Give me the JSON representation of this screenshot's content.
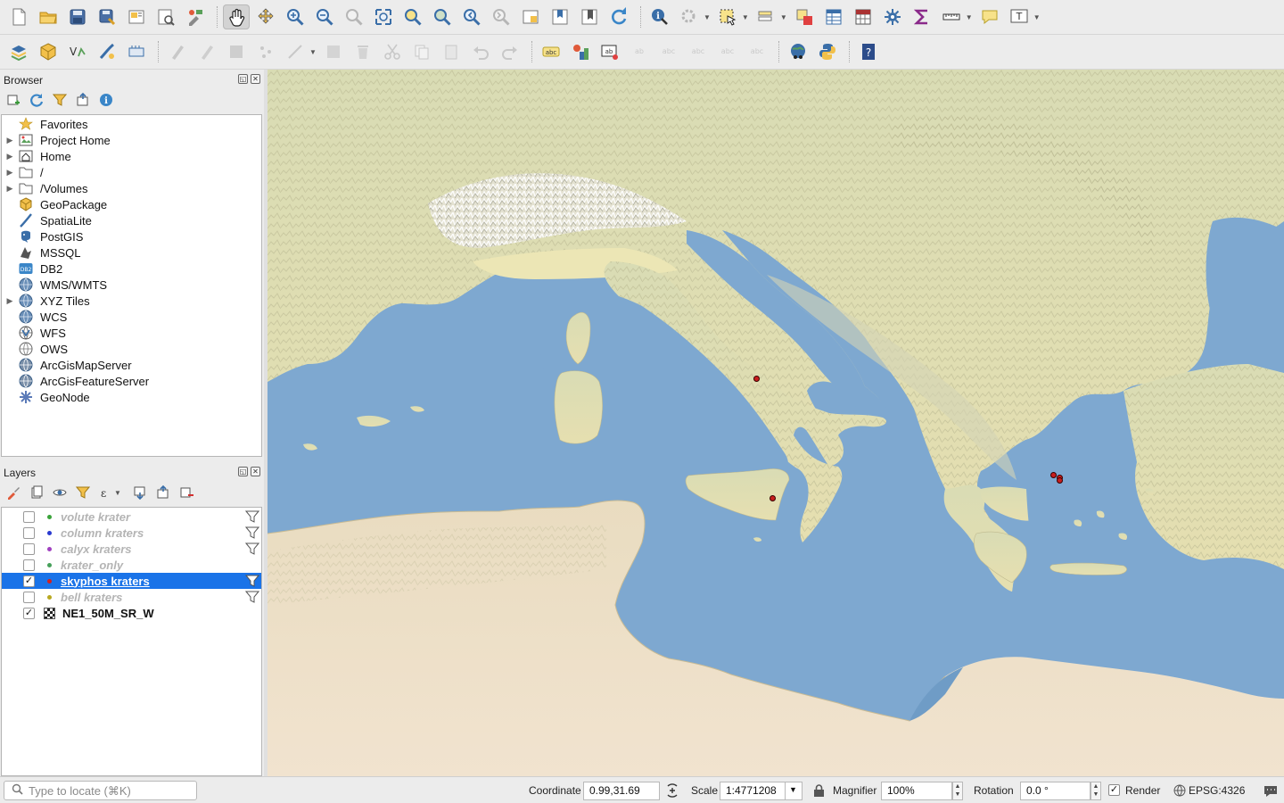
{
  "toolbar_main": {
    "items": [
      "new-project-icon",
      "open-project-icon",
      "save-project-icon",
      "save-as-icon",
      "print-layout-icon",
      "layout-manager-icon",
      "style-manager-icon",
      "pan-icon",
      "pan-to-selection-icon",
      "zoom-in-icon",
      "zoom-out-icon",
      "zoom-native-icon",
      "zoom-full-icon",
      "zoom-to-selection-icon",
      "zoom-to-layer-icon",
      "zoom-last-icon",
      "zoom-next-icon",
      "new-map-view-icon",
      "new-bookmark-icon",
      "show-bookmarks-icon",
      "refresh-icon",
      "identify-icon",
      "run-action-icon",
      "select-features-icon",
      "select-by-value-icon",
      "deselect-icon",
      "attribute-table-icon",
      "field-calculator-icon",
      "toolbox-icon",
      "statistics-icon",
      "measure-icon",
      "map-tips-icon",
      "text-annotation-icon"
    ]
  },
  "browser": {
    "title": "Browser",
    "items": [
      {
        "label": "Favorites",
        "icon": "star-icon",
        "expandable": false
      },
      {
        "label": "Project Home",
        "icon": "project-home-icon",
        "expandable": true
      },
      {
        "label": "Home",
        "icon": "home-icon",
        "expandable": true
      },
      {
        "label": "/",
        "icon": "folder-icon",
        "expandable": true
      },
      {
        "label": "/Volumes",
        "icon": "folder-icon",
        "expandable": true
      },
      {
        "label": "GeoPackage",
        "icon": "geopackage-icon",
        "expandable": false
      },
      {
        "label": "SpatiaLite",
        "icon": "spatialite-icon",
        "expandable": false
      },
      {
        "label": "PostGIS",
        "icon": "postgis-icon",
        "expandable": false
      },
      {
        "label": "MSSQL",
        "icon": "mssql-icon",
        "expandable": false
      },
      {
        "label": "DB2",
        "icon": "db2-icon",
        "expandable": false
      },
      {
        "label": "WMS/WMTS",
        "icon": "globe-icon",
        "expandable": false
      },
      {
        "label": "XYZ Tiles",
        "icon": "globe-icon",
        "expandable": true
      },
      {
        "label": "WCS",
        "icon": "globe-icon",
        "expandable": false
      },
      {
        "label": "WFS",
        "icon": "wfs-icon",
        "expandable": false
      },
      {
        "label": "OWS",
        "icon": "ows-icon",
        "expandable": false
      },
      {
        "label": "ArcGisMapServer",
        "icon": "arcgis-icon",
        "expandable": false
      },
      {
        "label": "ArcGisFeatureServer",
        "icon": "arcgis-icon",
        "expandable": false
      },
      {
        "label": "GeoNode",
        "icon": "geonode-icon",
        "expandable": false
      }
    ]
  },
  "layers": {
    "title": "Layers",
    "items": [
      {
        "name": "volute krater",
        "checked": false,
        "color": "#3aa33a",
        "filtered": true,
        "selected": false
      },
      {
        "name": "column kraters",
        "checked": false,
        "color": "#2a3ad0",
        "filtered": true,
        "selected": false
      },
      {
        "name": "calyx kraters",
        "checked": false,
        "color": "#a040c0",
        "filtered": true,
        "selected": false
      },
      {
        "name": "krater_only",
        "checked": false,
        "color": "#46a05a",
        "filtered": false,
        "selected": false
      },
      {
        "name": "skyphos kraters",
        "checked": true,
        "color": "#d42020",
        "filtered": true,
        "selected": true
      },
      {
        "name": "bell kraters",
        "checked": false,
        "color": "#b8a820",
        "filtered": true,
        "selected": false
      },
      {
        "name": "NE1_50M_SR_W",
        "checked": true,
        "color": "raster",
        "filtered": false,
        "selected": false
      }
    ]
  },
  "status": {
    "locate_placeholder": "Type to locate (⌘K)",
    "coordinate_label": "Coordinate",
    "coordinate_value": "0.99,31.69",
    "scale_label": "Scale",
    "scale_value": "1:4771208",
    "magnifier_label": "Magnifier",
    "magnifier_value": "100%",
    "rotation_label": "Rotation",
    "rotation_value": "0.0 °",
    "render_label": "Render",
    "render_checked": true,
    "crs_label": "EPSG:4326"
  },
  "map": {
    "feature_points": [
      {
        "name": "skyphos-point-campania"
      },
      {
        "name": "skyphos-point-sicily"
      },
      {
        "name": "skyphos-point-athens-1"
      },
      {
        "name": "skyphos-point-athens-2"
      },
      {
        "name": "skyphos-point-athens-3"
      }
    ]
  }
}
